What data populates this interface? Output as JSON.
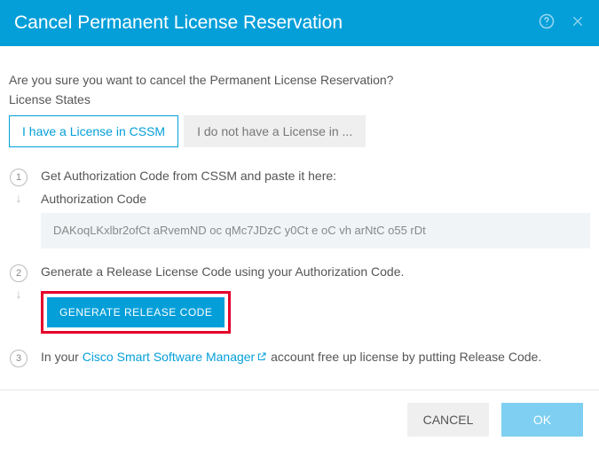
{
  "header": {
    "title": "Cancel Permanent License Reservation"
  },
  "body": {
    "question": "Are you sure you want to cancel the Permanent License Reservation?",
    "label": "License States"
  },
  "tabs": {
    "active": "I have a License in CSSM",
    "inactive": "I do not have a License in ..."
  },
  "steps": {
    "s1": {
      "num": "1",
      "text": "Get Authorization Code from CSSM and paste it here:",
      "auth_label": "Authorization Code",
      "code": "DAKoqLKxlbr2ofCt aRvemND oc qMc7JDzC y0Ct e oC vh arNtC o55 rDt"
    },
    "s2": {
      "num": "2",
      "text": "Generate a Release License Code using your Authorization Code.",
      "button": "GENERATE RELEASE CODE"
    },
    "s3": {
      "num": "3",
      "pre": "In your ",
      "link": "Cisco Smart Software Manager",
      "post": " account free up license by putting Release Code."
    }
  },
  "footer": {
    "cancel": "CANCEL",
    "ok": "OK"
  }
}
